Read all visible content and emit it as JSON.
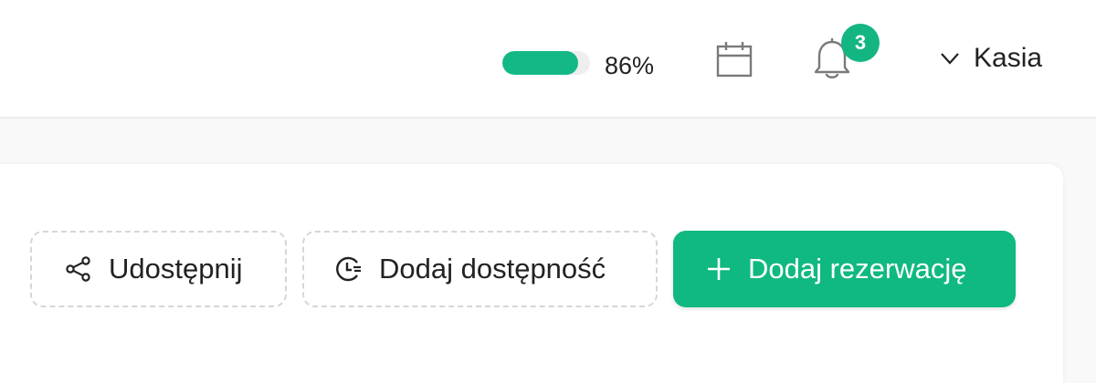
{
  "colors": {
    "accent": "#14b886",
    "badge": "#13b583",
    "primary_button": "#10b981"
  },
  "header": {
    "progress": {
      "value_percent": 86,
      "label": "86%"
    },
    "calendar_icon": "calendar-icon",
    "notifications": {
      "icon": "bell-icon",
      "count": "3"
    },
    "user": {
      "name": "Kasia",
      "chevron_icon": "chevron-down-icon"
    }
  },
  "actions": {
    "share": {
      "label": "Udostępnij",
      "icon": "share-icon"
    },
    "availability": {
      "label": "Dodaj dostępność",
      "icon": "clock-add-icon"
    },
    "add_reservation": {
      "label": "Dodaj rezerwację",
      "icon": "plus-icon"
    }
  }
}
